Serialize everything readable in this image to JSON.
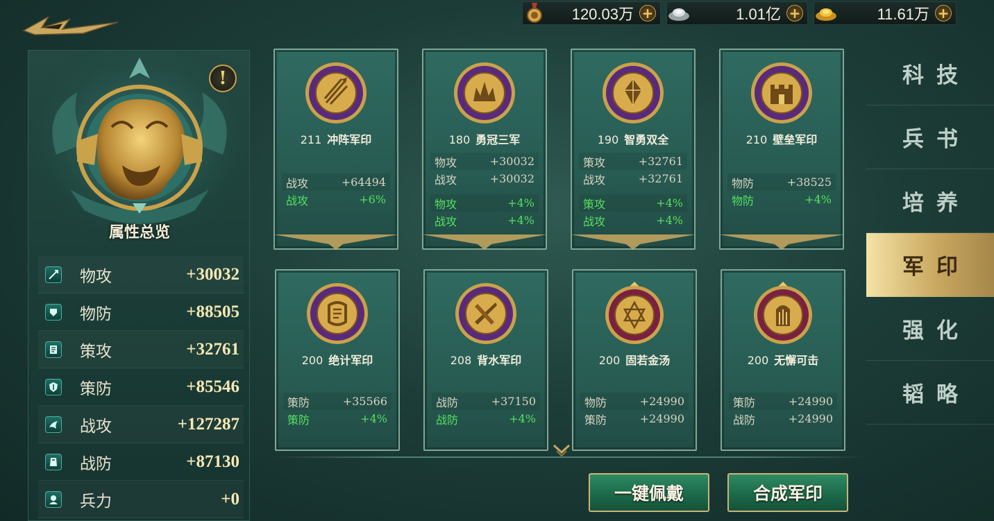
{
  "currency": [
    {
      "icon": "medal-token-icon",
      "value": "120.03万"
    },
    {
      "icon": "silver-ingot-icon",
      "value": "1.01亿"
    },
    {
      "icon": "gold-ingot-icon",
      "value": "11.61万"
    }
  ],
  "overview": {
    "title": "属性总览",
    "stats": [
      {
        "icon": "physical-attack-icon",
        "name": "物攻",
        "value": "+30032"
      },
      {
        "icon": "physical-defense-icon",
        "name": "物防",
        "value": "+88505"
      },
      {
        "icon": "strategy-attack-icon",
        "name": "策攻",
        "value": "+32761"
      },
      {
        "icon": "strategy-defense-icon",
        "name": "策防",
        "value": "+85546"
      },
      {
        "icon": "war-attack-icon",
        "name": "战攻",
        "value": "+127287"
      },
      {
        "icon": "war-defense-icon",
        "name": "战防",
        "value": "+87130"
      },
      {
        "icon": "troops-icon",
        "name": "兵力",
        "value": "+0"
      }
    ]
  },
  "seals": [
    {
      "level": "211",
      "name": "冲阵军印",
      "icon": "arrows-seal-icon",
      "attrs": [
        {
          "name": "战攻",
          "value": "+64494",
          "color": "white"
        },
        {
          "name": "战攻",
          "value": "+6%",
          "color": "green"
        }
      ]
    },
    {
      "level": "180",
      "name": "勇冠三军",
      "icon": "lotus-crown-seal-icon",
      "attrs": [
        {
          "name": "物攻",
          "value": "+30032",
          "color": "white"
        },
        {
          "name": "战攻",
          "value": "+30032",
          "color": "white"
        },
        {
          "name": "物攻",
          "value": "+4%",
          "color": "green"
        },
        {
          "name": "战攻",
          "value": "+4%",
          "color": "green"
        }
      ]
    },
    {
      "level": "190",
      "name": "智勇双全",
      "icon": "crystal-seal-icon",
      "attrs": [
        {
          "name": "策攻",
          "value": "+32761",
          "color": "white"
        },
        {
          "name": "战攻",
          "value": "+32761",
          "color": "white"
        },
        {
          "name": "策攻",
          "value": "+4%",
          "color": "green"
        },
        {
          "name": "战攻",
          "value": "+4%",
          "color": "green"
        }
      ]
    },
    {
      "level": "210",
      "name": "壁垒军印",
      "icon": "fortress-seal-icon",
      "attrs": [
        {
          "name": "物防",
          "value": "+38525",
          "color": "white"
        },
        {
          "name": "物防",
          "value": "+4%",
          "color": "green"
        }
      ]
    },
    {
      "level": "200",
      "name": "绝计军印",
      "icon": "scroll-seal-icon",
      "attrs": [
        {
          "name": "策防",
          "value": "+35566",
          "color": "white"
        },
        {
          "name": "策防",
          "value": "+4%",
          "color": "green"
        }
      ]
    },
    {
      "level": "208",
      "name": "背水军印",
      "icon": "crossed-blades-seal-icon",
      "attrs": [
        {
          "name": "战防",
          "value": "+37150",
          "color": "white"
        },
        {
          "name": "战防",
          "value": "+4%",
          "color": "green"
        }
      ]
    },
    {
      "level": "200",
      "name": "固若金汤",
      "icon": "hexagram-seal-icon",
      "attrs": [
        {
          "name": "物防",
          "value": "+24990",
          "color": "white"
        },
        {
          "name": "策防",
          "value": "+24990",
          "color": "white"
        }
      ]
    },
    {
      "level": "200",
      "name": "无懈可击",
      "icon": "shield-gate-seal-icon",
      "attrs": [
        {
          "name": "策防",
          "value": "+24990",
          "color": "white"
        },
        {
          "name": "战防",
          "value": "+24990",
          "color": "white"
        }
      ]
    }
  ],
  "buttons": {
    "equip_all": "一键佩戴",
    "compose": "合成军印"
  },
  "tabs": [
    {
      "label": "科技",
      "active": false
    },
    {
      "label": "兵书",
      "active": false
    },
    {
      "label": "培养",
      "active": false
    },
    {
      "label": "军印",
      "active": true
    },
    {
      "label": "强化",
      "active": false
    },
    {
      "label": "韬略",
      "active": false
    }
  ],
  "colors": {
    "green_bonus": "#56e05e",
    "gold_accent": "#c9a24a",
    "active_tab": "#f4e2a6",
    "seal_purple": "#5a2a7a"
  }
}
